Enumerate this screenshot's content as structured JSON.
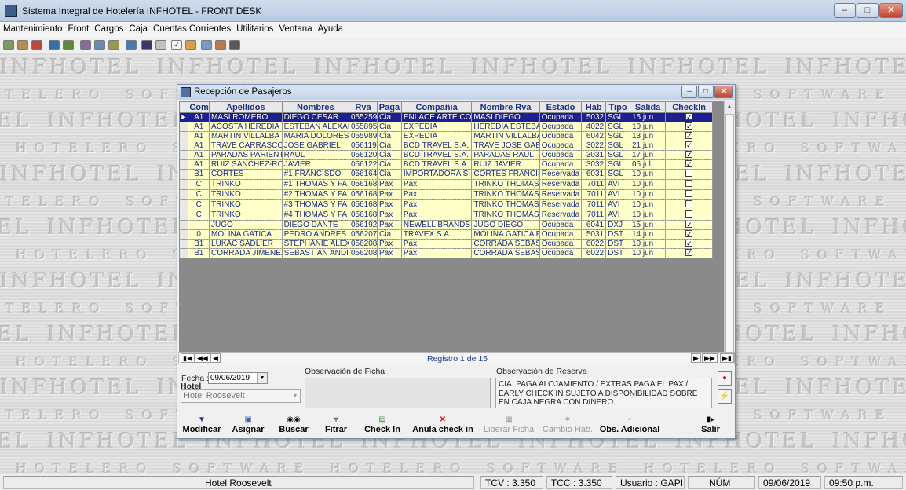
{
  "window": {
    "title": "Sistema Integral de Hotelería INFHOTEL - FRONT DESK"
  },
  "menu": [
    "Mantenimiento",
    "Front",
    "Cargos",
    "Caja",
    "Cuentas Corrientes",
    "Utilitarios",
    "Ventana",
    "Ayuda"
  ],
  "watermark": {
    "word1": "INFHOTEL",
    "word2": "SOFTWARE",
    "word3": "HOTELERO"
  },
  "child": {
    "title": "Recepción de Pasajeros",
    "columns": [
      "Com",
      "Apellidos",
      "Nombres",
      "Rva",
      "Paga",
      "Compañia",
      "Nombre Rva",
      "Estado",
      "Hab",
      "Tipo",
      "Salida",
      "CheckIn"
    ],
    "rows": [
      {
        "com": "A1",
        "apellidos": "MASI ROMERO",
        "nombres": "DIEGO CESAR",
        "rva": "055259",
        "paga": "Cia",
        "compania": "ENLACE ARTE CO",
        "nombre_rva": "MASI DIEGO",
        "estado": "Ocupada",
        "hab": "5032",
        "tipo": "SGL",
        "salida": "15 jun",
        "checkin": true
      },
      {
        "com": "A1",
        "apellidos": "ACOSTA HEREDIA",
        "nombres": "ESTEBAN ALEXAI",
        "rva": "055895",
        "paga": "Cia",
        "compania": "EXPEDIA",
        "nombre_rva": "HEREDIA ESTEBAN",
        "estado": "Ocupada",
        "hab": "4022",
        "tipo": "SGL",
        "salida": "10 jun",
        "checkin": true
      },
      {
        "com": "A1",
        "apellidos": "MARTIN VILLALBA",
        "nombres": "MARIA DOLORES",
        "rva": "055989",
        "paga": "Cia",
        "compania": "EXPEDIA",
        "nombre_rva": "MARTIN VILLALBA N",
        "estado": "Ocupada",
        "hab": "6042",
        "tipo": "SGL",
        "salida": "13 jun",
        "checkin": true
      },
      {
        "com": "A1",
        "apellidos": "TRAVE CARRASCO",
        "nombres": "JOSE GABRIEL",
        "rva": "056119",
        "paga": "Cia",
        "compania": "BCD TRAVEL S.A.",
        "nombre_rva": "TRAVE JOSE GABR",
        "estado": "Ocupada",
        "hab": "3022",
        "tipo": "SGL",
        "salida": "21 jun",
        "checkin": true
      },
      {
        "com": "A1",
        "apellidos": "PARADAS PARIENT",
        "nombres": "RAUL",
        "rva": "056120",
        "paga": "Cia",
        "compania": "BCD TRAVEL S.A.",
        "nombre_rva": "PARADAS RAUL",
        "estado": "Ocupada",
        "hab": "3031",
        "tipo": "SGL",
        "salida": "17 jun",
        "checkin": true
      },
      {
        "com": "A1",
        "apellidos": "RUIZ SANCHEZ-ROS",
        "nombres": "JAVIER",
        "rva": "056122",
        "paga": "Cia",
        "compania": "BCD TRAVEL S.A.",
        "nombre_rva": "RUIZ JAVIER",
        "estado": "Ocupada",
        "hab": "3032",
        "tipo": "SGL",
        "salida": "05 jul",
        "checkin": true
      },
      {
        "com": "B1",
        "apellidos": "CORTES",
        "nombres": "#1 FRANCISDO",
        "rva": "056164",
        "paga": "Cia",
        "compania": "IMPORTADORA SI",
        "nombre_rva": "CORTES FRANCISC",
        "estado": "Reservada",
        "hab": "6031",
        "tipo": "SGL",
        "salida": "10 jun",
        "checkin": false
      },
      {
        "com": "C",
        "apellidos": "TRINKO",
        "nombres": "#1 THOMAS Y FA",
        "rva": "056168",
        "paga": "Pax",
        "compania": "Pax",
        "nombre_rva": "TRINKO THOMAS Y",
        "estado": "Reservada",
        "hab": "7011",
        "tipo": "AVI",
        "salida": "10 jun",
        "checkin": false
      },
      {
        "com": "C",
        "apellidos": "TRINKO",
        "nombres": "#2 THOMAS Y FA",
        "rva": "056168",
        "paga": "Pax",
        "compania": "Pax",
        "nombre_rva": "TRINKO THOMAS Y",
        "estado": "Reservada",
        "hab": "7011",
        "tipo": "AVI",
        "salida": "10 jun",
        "checkin": false
      },
      {
        "com": "C",
        "apellidos": "TRINKO",
        "nombres": "#3 THOMAS Y FA",
        "rva": "056168",
        "paga": "Pax",
        "compania": "Pax",
        "nombre_rva": "TRINKO THOMAS Y",
        "estado": "Reservada",
        "hab": "7011",
        "tipo": "AVI",
        "salida": "10 jun",
        "checkin": false
      },
      {
        "com": "C",
        "apellidos": "TRINKO",
        "nombres": "#4 THOMAS Y FA",
        "rva": "056168",
        "paga": "Pax",
        "compania": "Pax",
        "nombre_rva": "TRINKO THOMAS Y",
        "estado": "Reservada",
        "hab": "7011",
        "tipo": "AVI",
        "salida": "10 jun",
        "checkin": false
      },
      {
        "com": "",
        "apellidos": "JUGO",
        "nombres": "DIEGO DANTE",
        "rva": "056192",
        "paga": "Pax",
        "compania": "NEWELL BRANDS",
        "nombre_rva": "JUGO DIEGO",
        "estado": "Ocupada",
        "hab": "6041",
        "tipo": "DXJ",
        "salida": "15 jun",
        "checkin": true
      },
      {
        "com": "0",
        "apellidos": "MOLINA GATICA",
        "nombres": "PEDRO ANDRES",
        "rva": "056207",
        "paga": "Cia",
        "compania": "TRAVEX S.A.",
        "nombre_rva": "MOLINA GATICA PE",
        "estado": "Ocupada",
        "hab": "5031",
        "tipo": "DST",
        "salida": "14 jun",
        "checkin": true
      },
      {
        "com": "B1",
        "apellidos": "LUKAC SADLIER",
        "nombres": "STEPHANIE ALEX",
        "rva": "056208",
        "paga": "Pax",
        "compania": "Pax",
        "nombre_rva": "CORRADA SEBAST",
        "estado": "Ocupada",
        "hab": "6022",
        "tipo": "DST",
        "salida": "10 jun",
        "checkin": true
      },
      {
        "com": "B1",
        "apellidos": "CORRADA JIMENEZ",
        "nombres": "SEBASTIAN ANDI",
        "rva": "056208",
        "paga": "Pax",
        "compania": "Pax",
        "nombre_rva": "CORRADA SEBAST",
        "estado": "Ocupada",
        "hab": "6022",
        "tipo": "DST",
        "salida": "10 jun",
        "checkin": true
      }
    ],
    "registro": "Registro 1 de 15",
    "fecha_label": "Fecha :",
    "fecha_value": "09/06/2019",
    "hotel_label": "Hotel",
    "hotel_value": "Hotel Roosevelt",
    "obs_ficha_label": "Observación de Ficha",
    "obs_ficha_value": "",
    "obs_reserva_label": "Observación de Reserva",
    "obs_reserva_value": "CIA. PAGA ALOJAMIENTO / EXTRAS PAGA EL PAX / EARLY CHECK IN SUJETO A DISPONIBILIDAD SOBRE EN CAJA NEGRA CON DINERO.",
    "actions": [
      {
        "label": "Modificar",
        "icon": "user-edit-icon",
        "enabled": true
      },
      {
        "label": "Asignar",
        "icon": "assign-icon",
        "enabled": true
      },
      {
        "label": "Buscar",
        "icon": "binoculars-icon",
        "enabled": true
      },
      {
        "label": "Fitrar",
        "icon": "filter-icon",
        "enabled": true
      },
      {
        "label": "Check In",
        "icon": "checkin-icon",
        "enabled": true
      },
      {
        "label": "Anula check in",
        "icon": "cancel-x-icon",
        "enabled": true
      },
      {
        "label": "Liberar Ficha",
        "icon": "release-icon",
        "enabled": false
      },
      {
        "label": "Cambio Hab.",
        "icon": "room-change-icon",
        "enabled": false
      },
      {
        "label": "Obs. Adicional",
        "icon": "note-icon",
        "enabled": true
      },
      {
        "label": "Salir",
        "icon": "exit-icon",
        "enabled": true
      }
    ]
  },
  "status": {
    "hotel": "Hotel Roosevelt",
    "tcv": "TCV : 3.350",
    "tcc": "TCC : 3.350",
    "usuario": "Usuario : GAPI",
    "num": "NÚM",
    "fecha": "09/06/2019",
    "hora": "09:50 p.m."
  }
}
